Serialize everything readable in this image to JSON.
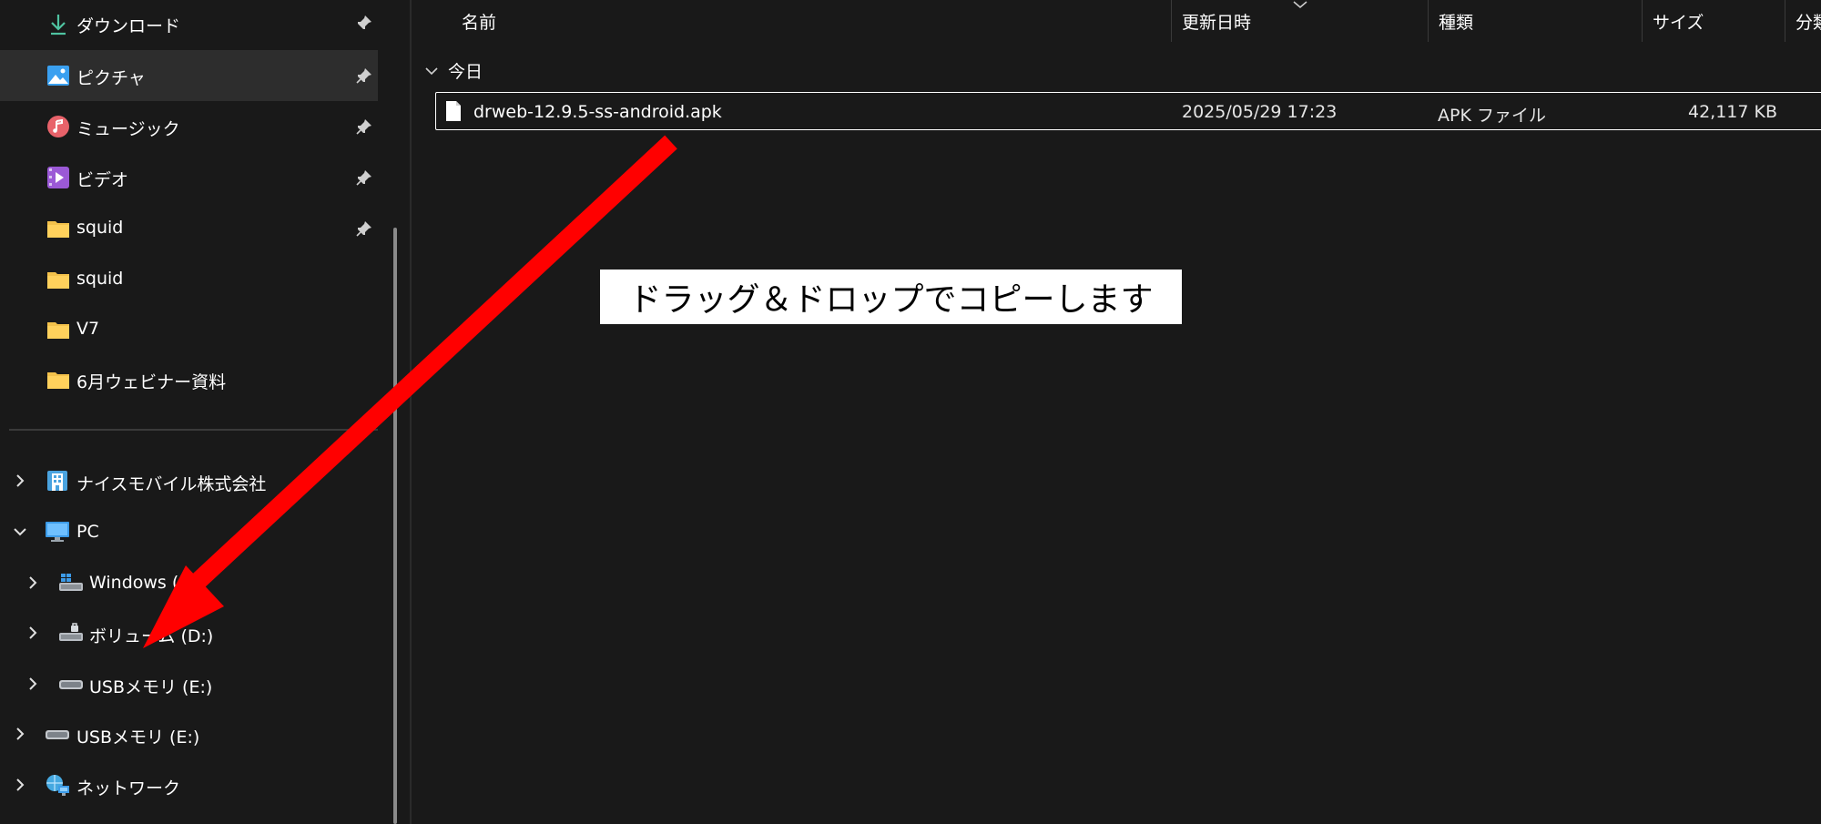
{
  "sidebar": {
    "quick_access": [
      {
        "label": "ダウンロード",
        "icon": "download-icon",
        "pinned": true
      },
      {
        "label": "ピクチャ",
        "icon": "pictures-icon",
        "pinned": true,
        "selected": true
      },
      {
        "label": "ミュージック",
        "icon": "music-icon",
        "pinned": true
      },
      {
        "label": "ビデオ",
        "icon": "video-icon",
        "pinned": true
      },
      {
        "label": "squid",
        "icon": "folder-icon",
        "pinned": true
      },
      {
        "label": "squid",
        "icon": "folder-icon",
        "pinned": false
      },
      {
        "label": "V7",
        "icon": "folder-icon",
        "pinned": false
      },
      {
        "label": "6月ウェビナー資料",
        "icon": "folder-icon",
        "pinned": false
      }
    ],
    "tree": [
      {
        "label": "ナイスモバイル株式会社",
        "icon": "building-icon",
        "expanded": false
      },
      {
        "label": "PC",
        "icon": "pc-icon",
        "expanded": true
      },
      {
        "label": "Windows (C:)",
        "icon": "windows-drive-icon",
        "expanded": false
      },
      {
        "label": "ボリューム (D:)",
        "icon": "drive-icon",
        "expanded": false
      },
      {
        "label": "USBメモリ (E:)",
        "icon": "usb-drive-icon",
        "expanded": false
      },
      {
        "label": "USBメモリ (E:)",
        "icon": "usb-drive-icon",
        "expanded": false
      },
      {
        "label": "ネットワーク",
        "icon": "network-icon",
        "expanded": false
      }
    ]
  },
  "columns": {
    "name": "名前",
    "modified": "更新日時",
    "type": "種類",
    "size": "サイズ",
    "extra": "分類"
  },
  "group": {
    "title": "今日"
  },
  "files": [
    {
      "name": "drweb-12.9.5-ss-android.apk",
      "modified": "2025/05/29 17:23",
      "type": "APK ファイル",
      "size": "42,117 KB"
    }
  ],
  "annotation": {
    "text": "ドラッグ＆ドロップでコピーします",
    "arrow_color": "#ff0000"
  },
  "colors": {
    "background": "#191919",
    "selected": "#2d2d2d",
    "folder": "#f3c14b"
  }
}
